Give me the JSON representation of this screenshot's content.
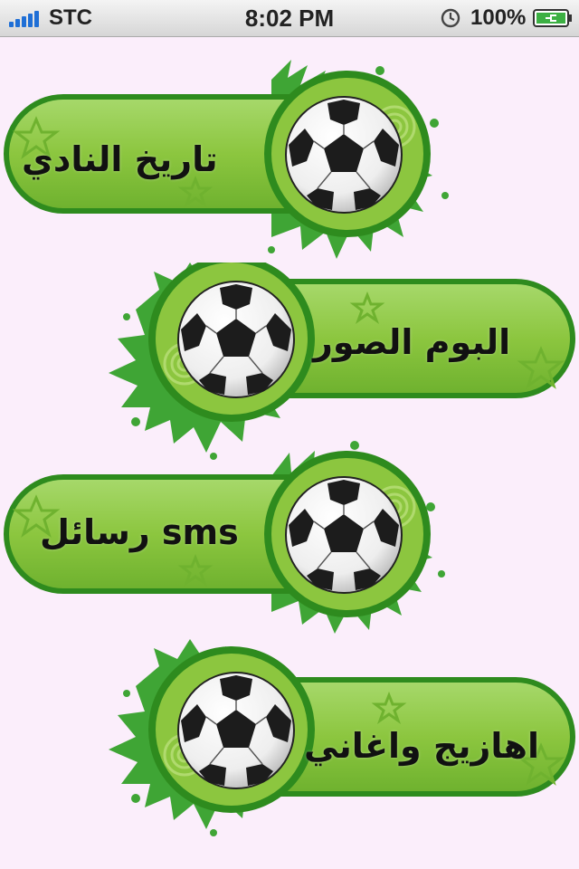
{
  "status_bar": {
    "carrier": "STC",
    "time": "8:02 PM",
    "battery": "100%",
    "icons": [
      "signal-icon",
      "alarm-icon",
      "battery-charging-icon"
    ]
  },
  "menu": {
    "items": [
      {
        "label": "تاريخ النادي"
      },
      {
        "label": "البوم الصور"
      },
      {
        "label": "رسائل sms"
      },
      {
        "label": "اهازيج واغاني"
      }
    ]
  },
  "colors": {
    "background": "#fbeefb",
    "banner_green": "#8cc63f",
    "banner_dark_green": "#2e8b1e",
    "splash_green": "#3fa535"
  }
}
